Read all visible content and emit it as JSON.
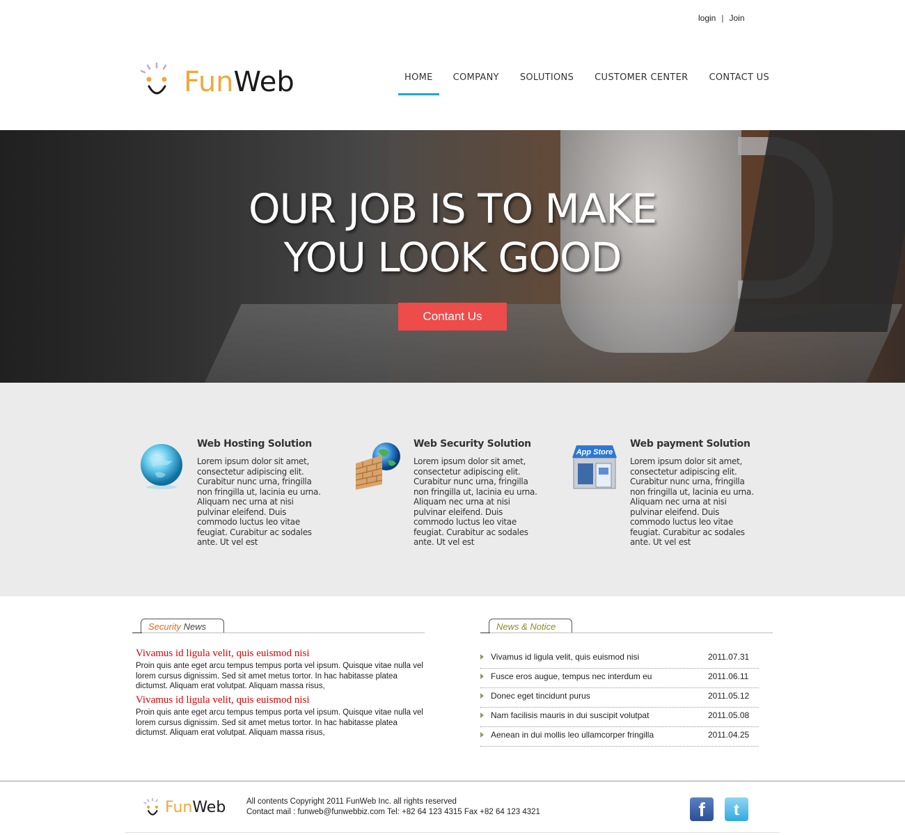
{
  "top_links": {
    "login": "login",
    "sep": "|",
    "join": "Join"
  },
  "logo": {
    "fun": "Fun",
    "web": "Web"
  },
  "nav": [
    {
      "label": "HOME",
      "active": true
    },
    {
      "label": "COMPANY"
    },
    {
      "label": "SOLUTIONS"
    },
    {
      "label": "CUSTOMER CENTER"
    },
    {
      "label": "CONTACT US"
    }
  ],
  "hero": {
    "title_line1": "OUR JOB IS TO MAKE",
    "title_line2": "YOU LOOK GOOD",
    "button": "Contant Us"
  },
  "features": [
    {
      "icon": "globe-icon",
      "title": "Web Hosting Solution",
      "text": "Lorem ipsum dolor sit amet, consectetur adipiscing elit. Curabitur nunc urna, fringilla non fringilla ut, lacinia eu urna. Aliquam nec urna at nisi pulvinar eleifend. Duis commodo luctus leo vitae feugiat. Curabitur ac sodales ante. Ut vel est"
    },
    {
      "icon": "firewall-globe-icon",
      "title": "Web Security Solution",
      "text": "Lorem ipsum dolor sit amet, consectetur adipiscing elit. Curabitur nunc urna, fringilla non fringilla ut, lacinia eu urna. Aliquam nec urna at nisi pulvinar eleifend. Duis commodo luctus leo vitae feugiat. Curabitur ac sodales ante. Ut vel est"
    },
    {
      "icon": "app-store-icon",
      "title": "Web payment Solution",
      "text": "Lorem ipsum dolor sit amet, consectetur adipiscing elit. Curabitur nunc urna, fringilla non fringilla ut, lacinia eu urna. Aliquam nec urna at nisi pulvinar eleifend. Duis commodo luctus leo vitae feugiat. Curabitur ac sodales ante. Ut vel est",
      "icon_label": "App Store"
    }
  ],
  "security_news": {
    "tab_a": "Security",
    "tab_b": "News",
    "posts": [
      {
        "title": "Vivamus id ligula velit, quis euismod nisi",
        "text": "Proin quis ante eget arcu tempus tempus porta vel ipsum. Quisque vitae nulla vel lorem cursus dignissim. Sed sit amet metus tortor. In hac habitasse platea dictumst. Aliquam erat volutpat. Aliquam massa risus,"
      },
      {
        "title": "Vivamus id ligula velit, quis euismod nisi",
        "text": "Proin quis ante eget arcu tempus tempus porta vel ipsum. Quisque vitae nulla vel lorem cursus dignissim. Sed sit amet metus tortor. In hac habitasse platea dictumst. Aliquam erat volutpat. Aliquam massa risus,"
      }
    ]
  },
  "notice": {
    "tab": "News & Notice",
    "items": [
      {
        "title": "Vivamus id ligula velit, quis euismod nisi",
        "date": "2011.07.31"
      },
      {
        "title": "Fusce eros augue, tempus nec interdum eu",
        "date": "2011.06.11"
      },
      {
        "title": "Donec eget tincidunt purus",
        "date": "2011.05.12"
      },
      {
        "title": "Nam facilisis mauris in dui suscipit volutpat",
        "date": "2011.05.08"
      },
      {
        "title": "Aenean in dui mollis leo ullamcorper fringilla",
        "date": "2011.04.25"
      }
    ]
  },
  "footer": {
    "logo_fun": "Fun",
    "logo_web": "Web",
    "line1": "All contents Copyright 2011 FunWeb Inc. all rights reserved",
    "line2": "Contact mail : funweb@funwebbiz.com Tel: +82 64 123 4315 Fax +82 64 123 4321",
    "facebook_glyph": "f",
    "twitter_glyph": "t"
  },
  "colors": {
    "accent": "#1aa7e0",
    "button": "#ee4b4b",
    "logo_orange": "#f2a73b",
    "news_title": "#dd0000"
  }
}
